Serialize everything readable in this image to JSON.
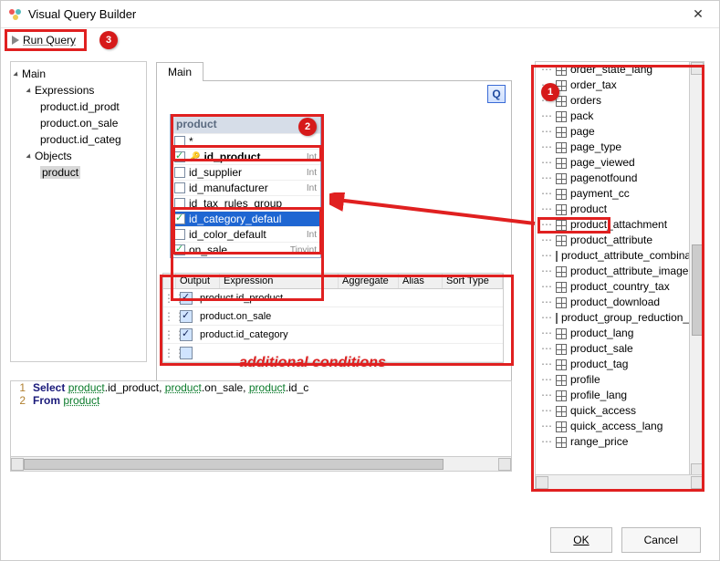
{
  "window": {
    "title": "Visual Query Builder",
    "close": "✕"
  },
  "toolbar": {
    "run_label": "Run Query"
  },
  "tree": {
    "root": "Main",
    "expr_label": "Expressions",
    "expr_items": [
      "product.id_prodt",
      "product.on_sale",
      "product.id_categ"
    ],
    "obj_label": "Objects",
    "obj_items": [
      "product"
    ]
  },
  "tabs": {
    "main": "Main"
  },
  "canvas": {
    "q_label": "Q"
  },
  "product_table": {
    "title": "product",
    "fields": [
      {
        "checked": false,
        "name": "*",
        "type": "",
        "key": false,
        "selected": false
      },
      {
        "checked": true,
        "name": "id_product",
        "type": "Int",
        "key": true,
        "selected": false
      },
      {
        "checked": false,
        "name": "id_supplier",
        "type": "Int",
        "key": false,
        "selected": false
      },
      {
        "checked": false,
        "name": "id_manufacturer",
        "type": "Int",
        "key": false,
        "selected": false
      },
      {
        "checked": false,
        "name": "id_tax_rules_group",
        "type": "",
        "key": false,
        "selected": false
      },
      {
        "checked": true,
        "name": "id_category_defaul",
        "type": "",
        "key": false,
        "selected": true
      },
      {
        "checked": false,
        "name": "id_color_default",
        "type": "Int",
        "key": false,
        "selected": false
      },
      {
        "checked": true,
        "name": "on_sale",
        "type": "Tinyint",
        "key": false,
        "selected": false
      }
    ]
  },
  "grid": {
    "headers": [
      "Output",
      "Expression",
      "Aggregate",
      "Alias",
      "Sort Type"
    ],
    "rows": [
      {
        "output": true,
        "expr": "product.id_product"
      },
      {
        "output": true,
        "expr": "product.on_sale"
      },
      {
        "output": true,
        "expr": "product.id_category"
      },
      {
        "output": false,
        "expr": ""
      }
    ]
  },
  "annotation": {
    "text": "additional conditions"
  },
  "right_panel": {
    "items": [
      "order_state_lang",
      "order_tax",
      "orders",
      "pack",
      "page",
      "page_type",
      "page_viewed",
      "pagenotfound",
      "payment_cc",
      "product",
      "product_attachment",
      "product_attribute",
      "product_attribute_combination",
      "product_attribute_image",
      "product_country_tax",
      "product_download",
      "product_group_reduction_ca",
      "product_lang",
      "product_sale",
      "product_tag",
      "profile",
      "profile_lang",
      "quick_access",
      "quick_access_lang",
      "range_price"
    ],
    "highlight_index": 9
  },
  "sql": {
    "lines": [
      {
        "n": "1",
        "kw": "Select",
        "body_before": " ",
        "idents": [
          "product",
          ".id_product, ",
          "product",
          ".on_sale, ",
          "product",
          ".id_c"
        ]
      },
      {
        "n": "2",
        "kw": "From",
        "body_before": " ",
        "idents": [
          "product",
          ""
        ]
      }
    ]
  },
  "buttons": {
    "ok": "OK",
    "cancel": "Cancel"
  },
  "badges": {
    "one": "1",
    "two": "2",
    "three": "3"
  }
}
